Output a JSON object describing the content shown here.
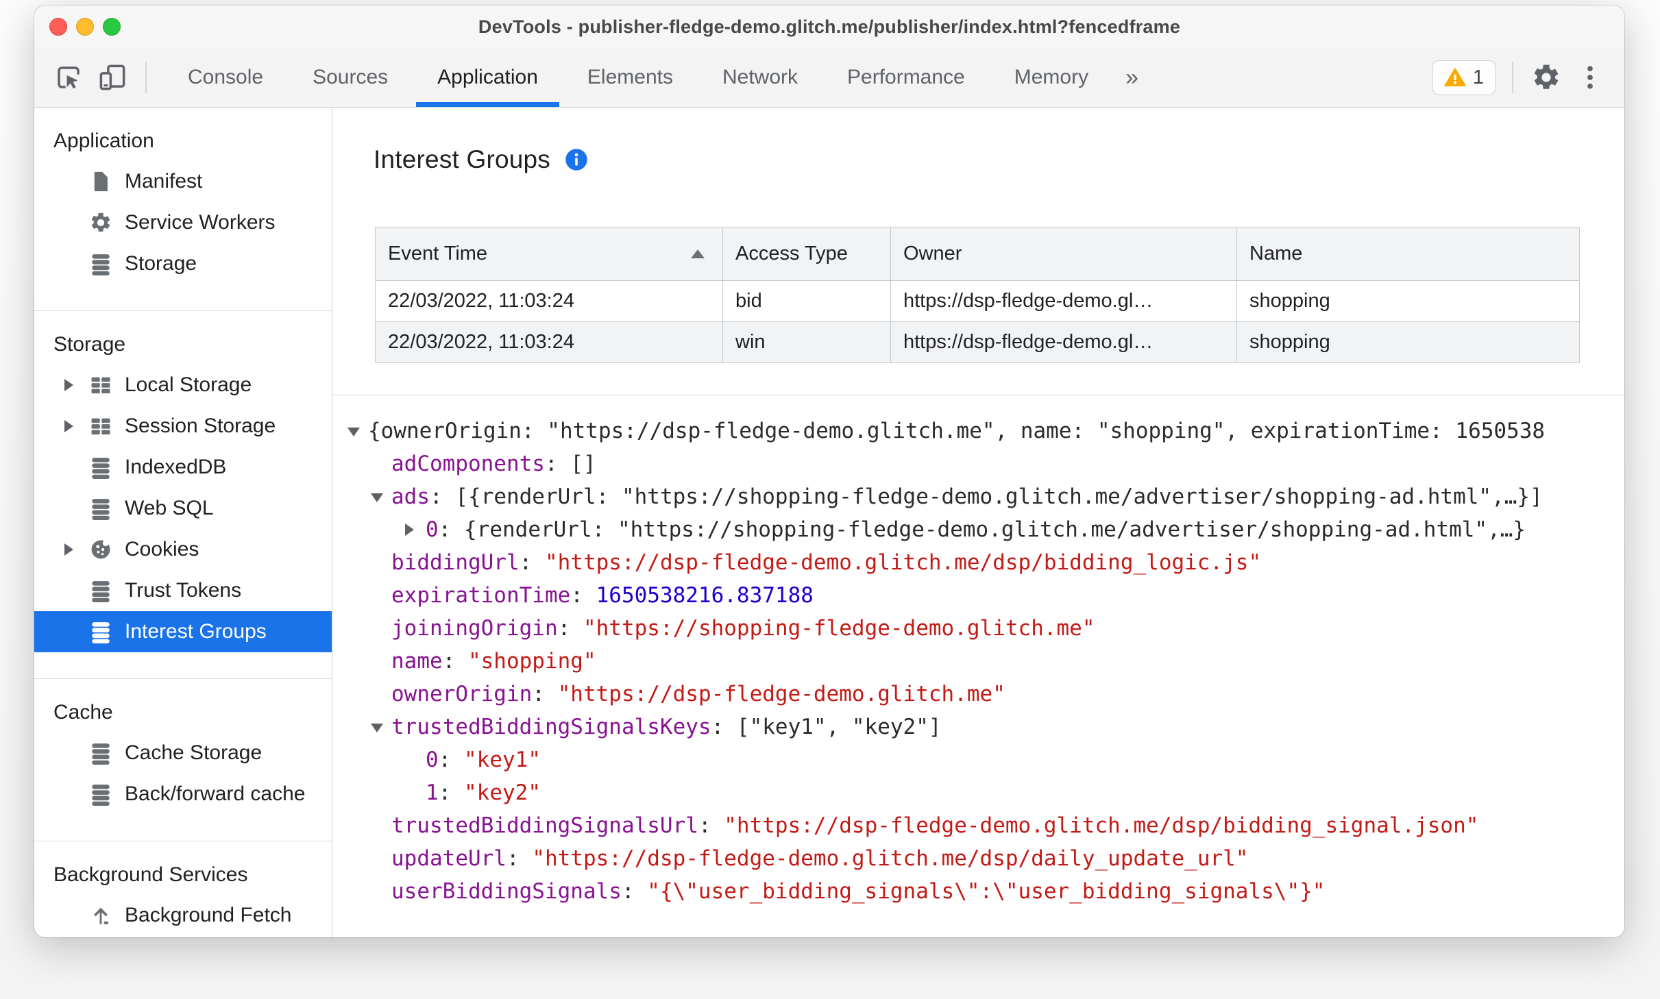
{
  "colors": {
    "accent": "#1a73e8",
    "selection_bg": "#1a73e8",
    "key": "#881391",
    "string": "#c41a16",
    "number": "#1c00cf",
    "warning": "#f9ab00"
  },
  "window": {
    "title": "DevTools - publisher-fledge-demo.glitch.me/publisher/index.html?fencedframe"
  },
  "toolbar": {
    "tabs": [
      "Console",
      "Sources",
      "Application",
      "Elements",
      "Network",
      "Performance",
      "Memory"
    ],
    "active_tab": "Application",
    "more_tabs_symbol": "»",
    "warning_count": "1"
  },
  "sidebar": {
    "sections": [
      {
        "title": "Application",
        "items": [
          {
            "label": "Manifest",
            "icon": "document"
          },
          {
            "label": "Service Workers",
            "icon": "gear"
          },
          {
            "label": "Storage",
            "icon": "database"
          }
        ]
      },
      {
        "title": "Storage",
        "items": [
          {
            "label": "Local Storage",
            "icon": "table",
            "expander": true
          },
          {
            "label": "Session Storage",
            "icon": "table",
            "expander": true
          },
          {
            "label": "IndexedDB",
            "icon": "database"
          },
          {
            "label": "Web SQL",
            "icon": "database"
          },
          {
            "label": "Cookies",
            "icon": "cookie",
            "expander": true
          },
          {
            "label": "Trust Tokens",
            "icon": "database"
          },
          {
            "label": "Interest Groups",
            "icon": "database",
            "selected": true
          }
        ]
      },
      {
        "title": "Cache",
        "items": [
          {
            "label": "Cache Storage",
            "icon": "database"
          },
          {
            "label": "Back/forward cache",
            "icon": "database"
          }
        ]
      },
      {
        "title": "Background Services",
        "items": [
          {
            "label": "Background Fetch",
            "icon": "fetch"
          }
        ]
      }
    ]
  },
  "main": {
    "title": "Interest Groups",
    "table": {
      "columns": [
        "Event Time",
        "Access Type",
        "Owner",
        "Name"
      ],
      "sorted_column": "Event Time",
      "sort_direction": "ascending",
      "rows": [
        [
          "22/03/2022, 11:03:24",
          "bid",
          "https://dsp-fledge-demo.gl…",
          "shopping"
        ],
        [
          "22/03/2022, 11:03:24",
          "win",
          "https://dsp-fledge-demo.gl…",
          "shopping"
        ]
      ]
    },
    "tree": {
      "rows": [
        {
          "indent": 0,
          "arrow": "down",
          "key": "",
          "value": "{ownerOrigin: \"https://dsp-fledge-demo.glitch.me\", name: \"shopping\", expirationTime: 1650538",
          "value_style": "preview"
        },
        {
          "indent": 1,
          "arrow": "",
          "key": "adComponents",
          "value": "[]",
          "value_style": "preview"
        },
        {
          "indent": 1,
          "arrow": "down",
          "key": "ads",
          "value": "[{renderUrl: \"https://shopping-fledge-demo.glitch.me/advertiser/shopping-ad.html\",…}]",
          "value_style": "preview"
        },
        {
          "indent": 2,
          "arrow": "right",
          "key": "0",
          "value": "{renderUrl: \"https://shopping-fledge-demo.glitch.me/advertiser/shopping-ad.html\",…}",
          "value_style": "preview"
        },
        {
          "indent": 1,
          "arrow": "",
          "key": "biddingUrl",
          "value": "\"https://dsp-fledge-demo.glitch.me/dsp/bidding_logic.js\"",
          "value_style": "string"
        },
        {
          "indent": 1,
          "arrow": "",
          "key": "expirationTime",
          "value": "1650538216.837188",
          "value_style": "number"
        },
        {
          "indent": 1,
          "arrow": "",
          "key": "joiningOrigin",
          "value": "\"https://shopping-fledge-demo.glitch.me\"",
          "value_style": "string"
        },
        {
          "indent": 1,
          "arrow": "",
          "key": "name",
          "value": "\"shopping\"",
          "value_style": "string"
        },
        {
          "indent": 1,
          "arrow": "",
          "key": "ownerOrigin",
          "value": "\"https://dsp-fledge-demo.glitch.me\"",
          "value_style": "string"
        },
        {
          "indent": 1,
          "arrow": "down",
          "key": "trustedBiddingSignalsKeys",
          "value": "[\"key1\", \"key2\"]",
          "value_style": "preview"
        },
        {
          "indent": 2,
          "arrow": "",
          "key": "0",
          "value": "\"key1\"",
          "value_style": "string"
        },
        {
          "indent": 2,
          "arrow": "",
          "key": "1",
          "value": "\"key2\"",
          "value_style": "string"
        },
        {
          "indent": 1,
          "arrow": "",
          "key": "trustedBiddingSignalsUrl",
          "value": "\"https://dsp-fledge-demo.glitch.me/dsp/bidding_signal.json\"",
          "value_style": "string"
        },
        {
          "indent": 1,
          "arrow": "",
          "key": "updateUrl",
          "value": "\"https://dsp-fledge-demo.glitch.me/dsp/daily_update_url\"",
          "value_style": "string"
        },
        {
          "indent": 1,
          "arrow": "",
          "key": "userBiddingSignals",
          "value": "\"{\\\"user_bidding_signals\\\":\\\"user_bidding_signals\\\"}\"",
          "value_style": "string"
        }
      ]
    }
  }
}
